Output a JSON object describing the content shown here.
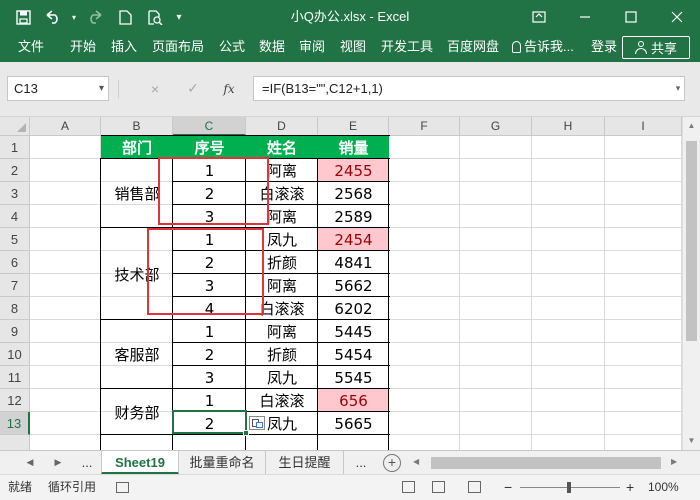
{
  "window": {
    "title": "小Q办公.xlsx - Excel",
    "save_icon": "save-icon",
    "undo_icon": "undo-icon",
    "redo_icon": "redo-icon",
    "new_icon": "new-document-icon",
    "preview_icon": "print-preview-icon",
    "customize_icon": "customize-quick-access-icon"
  },
  "ribbon": {
    "tabs": [
      "文件",
      "开始",
      "插入",
      "页面布局",
      "公式",
      "数据",
      "审阅",
      "视图",
      "开发工具",
      "百度网盘"
    ],
    "tell_me": "告诉我...",
    "login": "登录",
    "share": "共享",
    "accent": "#217346"
  },
  "formula_bar": {
    "name_box": "C13",
    "cancel_glyph": "×",
    "enter_glyph": "✓",
    "fx_label": "fx",
    "formula": "=IF(B13=\"\",C12+1,1)"
  },
  "columns": [
    "A",
    "B",
    "C",
    "D",
    "E",
    "F",
    "G",
    "H",
    "I"
  ],
  "rows": [
    "1",
    "2",
    "3",
    "4",
    "5",
    "6",
    "7",
    "8",
    "9",
    "10",
    "11",
    "12",
    "13"
  ],
  "table": {
    "headers": {
      "dept": "部门",
      "seq": "序号",
      "name": "姓名",
      "sales": "销量"
    },
    "groups": [
      {
        "dept": "销售部",
        "rows": [
          {
            "seq": "1",
            "name": "阿离",
            "sales": "2455",
            "highlight": true
          },
          {
            "seq": "2",
            "name": "白滚滚",
            "sales": "2568",
            "highlight": false
          },
          {
            "seq": "3",
            "name": "阿离",
            "sales": "2589",
            "highlight": false
          }
        ]
      },
      {
        "dept": "技术部",
        "rows": [
          {
            "seq": "1",
            "name": "凤九",
            "sales": "2454",
            "highlight": true
          },
          {
            "seq": "2",
            "name": "折颜",
            "sales": "4841",
            "highlight": false
          },
          {
            "seq": "3",
            "name": "阿离",
            "sales": "5662",
            "highlight": false
          },
          {
            "seq": "4",
            "name": "白滚滚",
            "sales": "6202",
            "highlight": false
          }
        ]
      },
      {
        "dept": "客服部",
        "rows": [
          {
            "seq": "1",
            "name": "阿离",
            "sales": "5445",
            "highlight": false
          },
          {
            "seq": "2",
            "name": "折颜",
            "sales": "5454",
            "highlight": false
          },
          {
            "seq": "3",
            "name": "凤九",
            "sales": "5545",
            "highlight": false
          }
        ]
      },
      {
        "dept": "财务部",
        "rows": [
          {
            "seq": "1",
            "name": "白滚滚",
            "sales": "656",
            "highlight": true
          },
          {
            "seq": "2",
            "name": "凤九",
            "sales": "5665",
            "highlight": false
          }
        ]
      }
    ],
    "header_color": "#00b050",
    "highlight_color": "#ffc7ce"
  },
  "sheet_tabs": {
    "more_left": "...",
    "tabs": [
      "Sheet19",
      "批量重命名",
      "生日提醒"
    ],
    "active": 0,
    "more_right": "..."
  },
  "status": {
    "ready": "就绪",
    "circular": "循环引用",
    "zoom": "100%"
  }
}
